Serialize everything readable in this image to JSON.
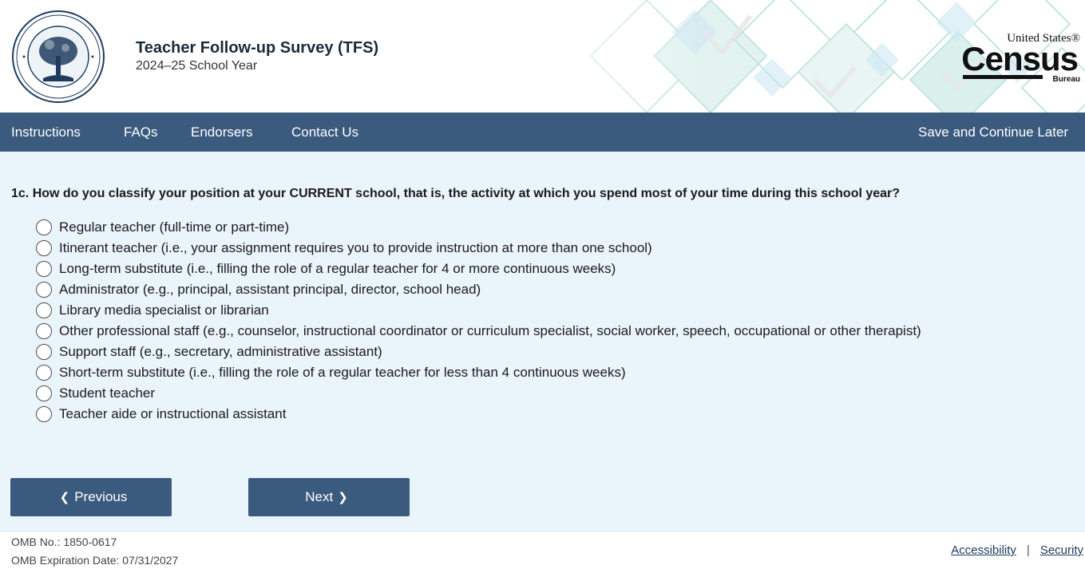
{
  "header": {
    "seal_alt": "DEPARTMENT OF EDUCATION · UNITED STATES OF AMERICA",
    "title": "Teacher Follow-up Survey (TFS)",
    "year": "2024–25 School Year",
    "census_logo": {
      "line1": "United States®",
      "line2": "Census",
      "line3": "Bureau"
    }
  },
  "nav": {
    "items": [
      "Instructions",
      "FAQs",
      "Endorsers",
      "Contact Us"
    ],
    "save_later": "Save and Continue Later"
  },
  "question": {
    "text": "1c. How do you classify your position at your CURRENT school, that is, the activity at which you spend most of your time during this school year?",
    "options": [
      "Regular teacher (full-time or part-time)",
      "Itinerant teacher (i.e., your assignment requires you to provide instruction at more than one school)",
      "Long-term substitute (i.e., filling the role of a regular teacher for 4 or more continuous weeks)",
      "Administrator (e.g., principal, assistant principal, director, school head)",
      "Library media specialist or librarian",
      "Other professional staff (e.g., counselor, instructional coordinator or curriculum specialist, social worker, speech, occupational or other therapist)",
      "Support staff (e.g., secretary, administrative assistant)",
      "Short-term substitute (i.e., filling the role of a regular teacher for less than 4 continuous weeks)",
      "Student teacher",
      "Teacher aide or instructional assistant"
    ]
  },
  "buttons": {
    "previous": "Previous",
    "next": "Next"
  },
  "footer": {
    "omb_no": "OMB No.: 1850-0617",
    "omb_expiration": "OMB Expiration Date: 07/31/2027",
    "accessibility": "Accessibility",
    "separator": "|",
    "security": "Security"
  },
  "colors": {
    "nav_bg": "#3a5a7e",
    "main_bg": "#eaf4fb",
    "button_bg": "#3a5a7e",
    "header_pattern": "#c7e8e4"
  }
}
